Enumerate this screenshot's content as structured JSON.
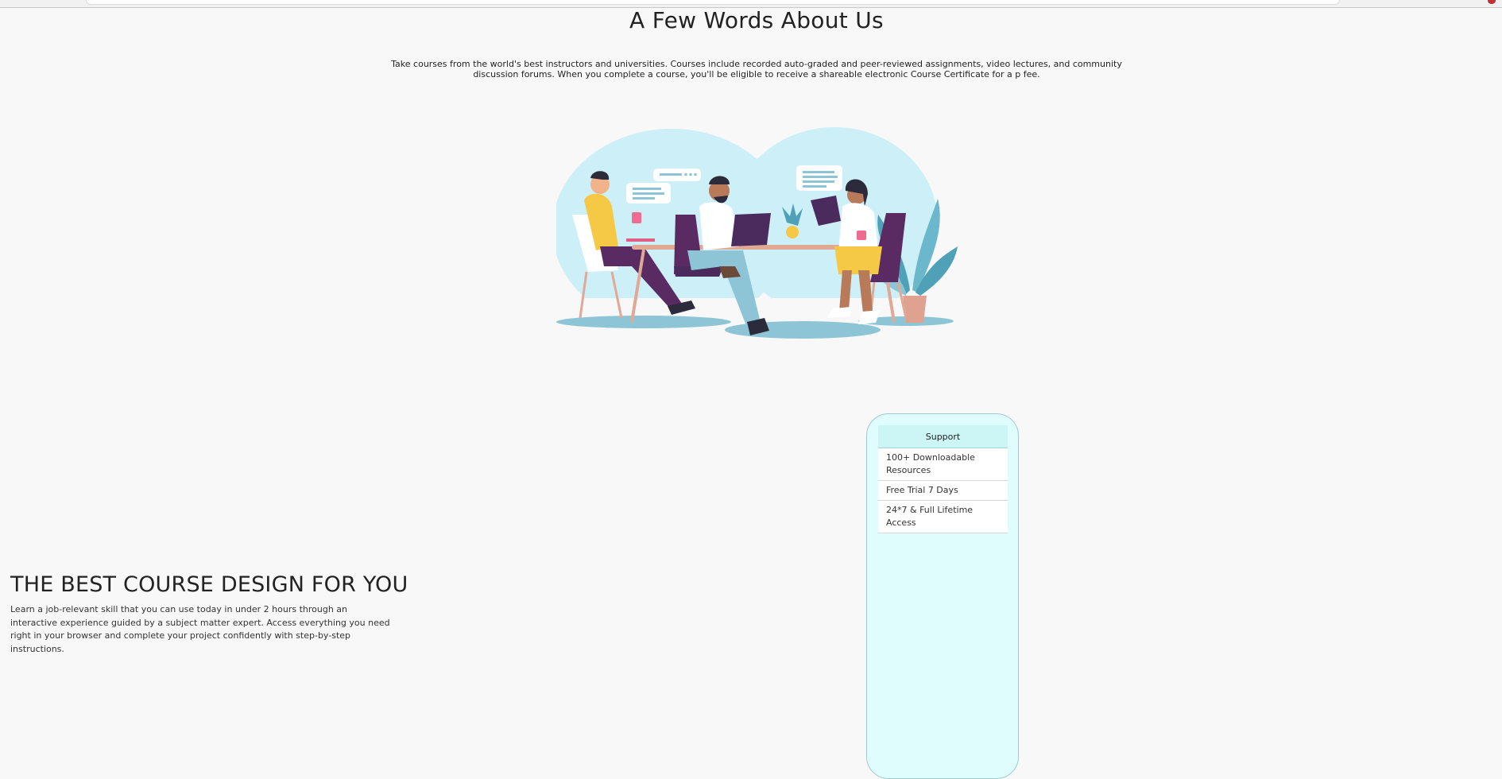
{
  "about": {
    "title": "A Few Words About Us",
    "text": "Take courses from the world's best instructors and universities. Courses include recorded auto-graded and peer-reviewed assignments, video lectures, and community discussion forums. When you complete a course, you'll be eligible to receive a shareable electronic Course Certificate for a p fee."
  },
  "illustration": {
    "icon": "team-working-illustration",
    "colors": {
      "blob": "#cdeff7",
      "shadow": "#8ec5d6",
      "table": "#e0a995",
      "purple": "#5a2b63",
      "yellow": "#f5c945",
      "laptop": "#4b2a5e",
      "plant": "#4fa1b8",
      "pot": "#e0a290"
    }
  },
  "design": {
    "title": "THE BEST COURSE DESIGN FOR YOU",
    "text": "Learn a job-relevant skill that you can use today in under 2 hours through an interactive experience guided by a subject matter expert. Access everything you need right in your browser and complete your project confidently with step-by-step instructions."
  },
  "support": {
    "header": "Support",
    "rows": [
      "100+ Downloadable Resources",
      "Free Trial 7 Days",
      "24*7 & Full Lifetime Access"
    ]
  }
}
